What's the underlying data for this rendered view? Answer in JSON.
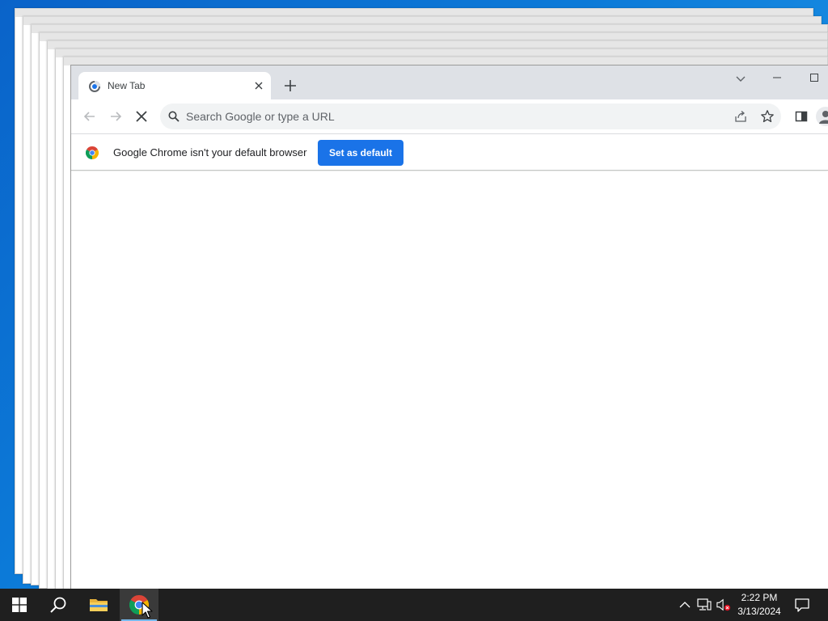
{
  "browser": {
    "tab": {
      "title": "New Tab"
    },
    "omnibox": {
      "placeholder": "Search Google or type a URL",
      "value": ""
    },
    "infobar": {
      "message": "Google Chrome isn't your default browser",
      "button_label": "Set as default"
    },
    "colors": {
      "accent": "#1a73e8",
      "tabstrip": "#dee1e6"
    }
  },
  "taskbar": {
    "clock": {
      "time": "2:22 PM",
      "date": "3/13/2024"
    },
    "apps": [
      "start",
      "search",
      "file-explorer",
      "chrome"
    ]
  },
  "icons": {
    "favicon": "chrome-newtab-icon",
    "nav": [
      "back-arrow-icon",
      "forward-arrow-icon",
      "stop-loading-icon"
    ],
    "tray": [
      "chevron-up-icon",
      "network-icon",
      "volume-muted-icon",
      "notification-icon"
    ]
  }
}
